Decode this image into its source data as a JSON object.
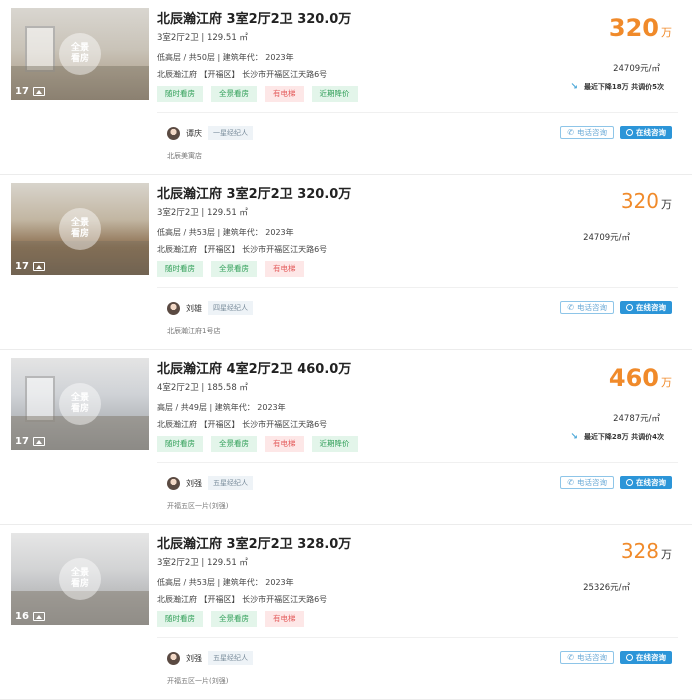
{
  "listings": [
    {
      "photo_count": "17",
      "vr_label": "全景\n看房",
      "title": "北辰瀚江府 3室2厅2卫 320.0万",
      "spec": "3室2厅2卫 | 129.51 ㎡",
      "floor_info": "低高层 / 共50层 | 建筑年代： 2023年",
      "address": "北辰瀚江府 【开福区】 长沙市开福区江天路6号",
      "tags": [
        "随时看房",
        "全景看房",
        "有电梯",
        "近期降价"
      ],
      "price": "320",
      "price_unit": "万",
      "unit_price": "24709元/㎡",
      "price_drop": "最近下降18万  共调价5次",
      "agent_name": "谭庆",
      "agent_level": "一星经纪人",
      "store": "北辰美寓店",
      "phone_label": "电话咨询",
      "chat_label": "在线咨询"
    },
    {
      "photo_count": "17",
      "vr_label": "全景\n看房",
      "title": "北辰瀚江府 3室2厅2卫 320.0万",
      "spec": "3室2厅2卫 | 129.51 ㎡",
      "floor_info": "低高层 / 共53层 | 建筑年代： 2023年",
      "address": "北辰瀚江府 【开福区】 长沙市开福区江天路6号",
      "tags": [
        "随时看房",
        "全景看房",
        "有电梯"
      ],
      "price": "320",
      "price_unit": "万",
      "unit_price": "24709元/㎡",
      "price_drop": "",
      "agent_name": "刘雄",
      "agent_level": "四星经纪人",
      "store": "北辰瀚江府1号店",
      "phone_label": "电话咨询",
      "chat_label": "在线咨询"
    },
    {
      "photo_count": "17",
      "vr_label": "全景\n看房",
      "title": "北辰瀚江府 4室2厅2卫 460.0万",
      "spec": "4室2厅2卫 | 185.58 ㎡",
      "floor_info": "高层 / 共49层 | 建筑年代： 2023年",
      "address": "北辰瀚江府 【开福区】 长沙市开福区江天路6号",
      "tags": [
        "随时看房",
        "全景看房",
        "有电梯",
        "近期降价"
      ],
      "price": "460",
      "price_unit": "万",
      "unit_price": "24787元/㎡",
      "price_drop": "最近下降28万  共调价4次",
      "agent_name": "刘强",
      "agent_level": "五星经纪人",
      "store": "开福五区一片(刘强)",
      "phone_label": "电话咨询",
      "chat_label": "在线咨询"
    },
    {
      "photo_count": "16",
      "vr_label": "全景\n看房",
      "title": "北辰瀚江府 3室2厅2卫 328.0万",
      "spec": "3室2厅2卫 | 129.51 ㎡",
      "floor_info": "低高层 / 共53层 | 建筑年代： 2023年",
      "address": "北辰瀚江府 【开福区】 长沙市开福区江天路6号",
      "tags": [
        "随时看房",
        "全景看房",
        "有电梯"
      ],
      "price": "328",
      "price_unit": "万",
      "unit_price": "25326元/㎡",
      "price_drop": "",
      "agent_name": "刘强",
      "agent_level": "五星经纪人",
      "store": "开福五区一片(刘强)",
      "phone_label": "电话咨询",
      "chat_label": "在线咨询"
    }
  ],
  "colors": {
    "price": "#f08a2a",
    "tag_green_bg": "#e3f5ea",
    "tag_red_bg": "#fde7e7",
    "chat_button": "#2c95d8"
  }
}
